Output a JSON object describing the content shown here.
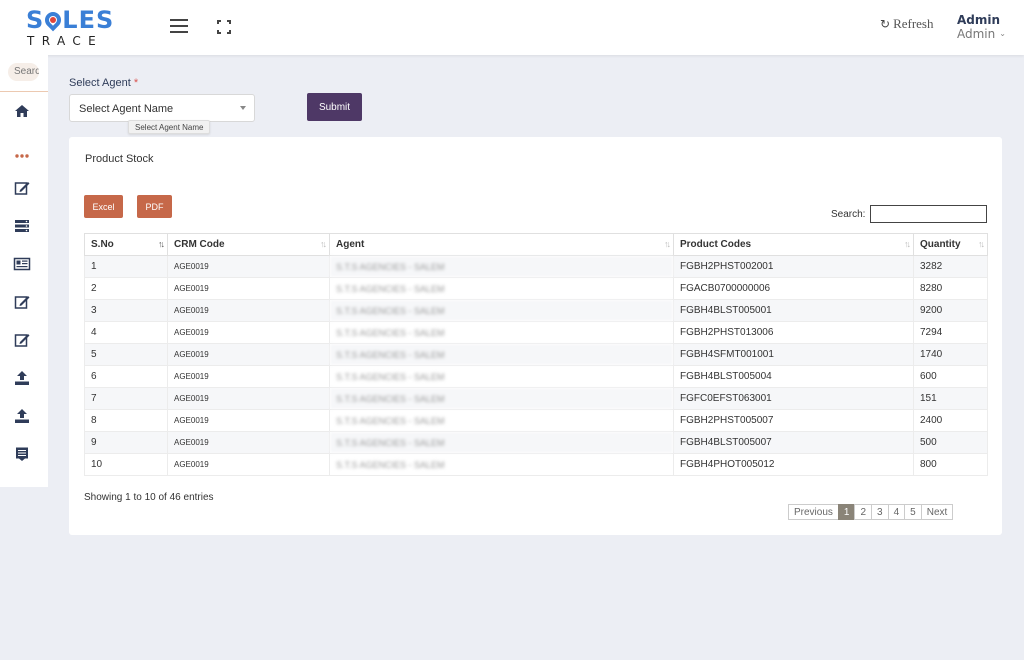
{
  "brand": {
    "logo_top_left": "S",
    "logo_top_right": "LES",
    "logo_bottom": "TRACE"
  },
  "header": {
    "refresh_label": "Refresh",
    "user_name": "Admin",
    "user_role": "Admin"
  },
  "sidebar": {
    "search_placeholder": "Search"
  },
  "filter": {
    "label": "Select Agent",
    "required_mark": "*",
    "select_value": "Select Agent Name",
    "tooltip": "Select Agent Name",
    "submit_label": "Submit"
  },
  "card": {
    "title": "Product Stock",
    "excel_label": "Excel",
    "pdf_label": "PDF",
    "search_label": "Search:",
    "columns": [
      "S.No",
      "CRM Code",
      "Agent",
      "Product Codes",
      "Quantity"
    ],
    "rows": [
      [
        "1",
        "AGE0019",
        "S.T.S AGENCIES - SALEM",
        "FGBH2PHST002001",
        "3282"
      ],
      [
        "2",
        "AGE0019",
        "S.T.S AGENCIES - SALEM",
        "FGACB0700000006",
        "8280"
      ],
      [
        "3",
        "AGE0019",
        "S.T.S AGENCIES - SALEM",
        "FGBH4BLST005001",
        "9200"
      ],
      [
        "4",
        "AGE0019",
        "S.T.S AGENCIES - SALEM",
        "FGBH2PHST013006",
        "7294"
      ],
      [
        "5",
        "AGE0019",
        "S.T.S AGENCIES - SALEM",
        "FGBH4SFMT001001",
        "1740"
      ],
      [
        "6",
        "AGE0019",
        "S.T.S AGENCIES - SALEM",
        "FGBH4BLST005004",
        "600"
      ],
      [
        "7",
        "AGE0019",
        "S.T.S AGENCIES - SALEM",
        "FGFC0EFST063001",
        "151"
      ],
      [
        "8",
        "AGE0019",
        "S.T.S AGENCIES - SALEM",
        "FGBH2PHST005007",
        "2400"
      ],
      [
        "9",
        "AGE0019",
        "S.T.S AGENCIES - SALEM",
        "FGBH4BLST005007",
        "500"
      ],
      [
        "10",
        "AGE0019",
        "S.T.S AGENCIES - SALEM",
        "FGBH4PHOT005012",
        "800"
      ]
    ],
    "info": "Showing 1 to 10 of 46 entries",
    "pager": {
      "previous": "Previous",
      "pages": [
        "1",
        "2",
        "3",
        "4",
        "5"
      ],
      "next": "Next",
      "current": "1"
    }
  },
  "colors": {
    "brand_blue": "#3a7fd6",
    "submit": "#4e3866",
    "export": "#c66849",
    "active_page": "#8a8478"
  }
}
